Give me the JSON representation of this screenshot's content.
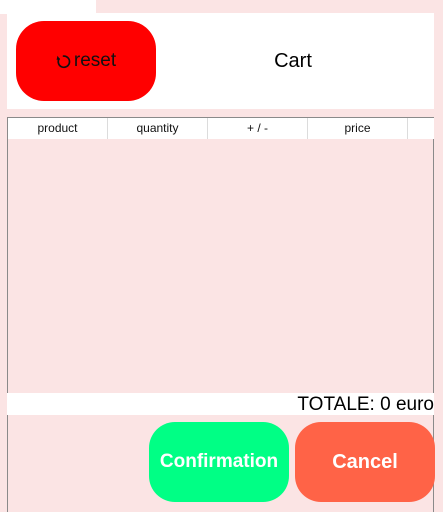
{
  "header": {
    "reset_label": "reset",
    "reset_icon": "reset-icon",
    "title": "Cart"
  },
  "table": {
    "columns": [
      "product",
      "quantity",
      "+ / -",
      "price",
      ""
    ],
    "rows": []
  },
  "summary": {
    "total_text": "TOTALE: 0 euro"
  },
  "actions": {
    "confirm_label": "Confirmation",
    "cancel_label": "Cancel"
  },
  "colors": {
    "background": "#fbe4e4",
    "reset": "#ff0000",
    "confirm": "#00ff85",
    "cancel": "#ff6347"
  }
}
